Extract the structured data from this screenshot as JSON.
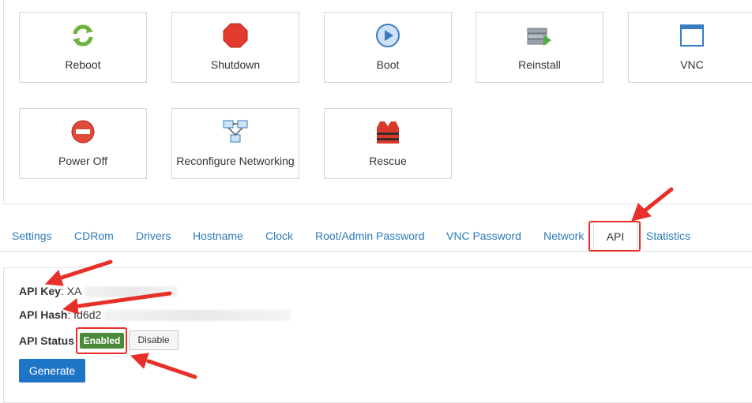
{
  "actions": [
    {
      "label": "Reboot",
      "icon": "reboot-icon"
    },
    {
      "label": "Shutdown",
      "icon": "shutdown-icon"
    },
    {
      "label": "Boot",
      "icon": "boot-icon"
    },
    {
      "label": "Reinstall",
      "icon": "reinstall-icon"
    },
    {
      "label": "VNC",
      "icon": "vnc-icon"
    },
    {
      "label": "Power Off",
      "icon": "power-off-icon"
    },
    {
      "label": "Reconfigure Networking",
      "icon": "network-icon"
    },
    {
      "label": "Rescue",
      "icon": "rescue-icon"
    }
  ],
  "tabs": [
    {
      "label": "Settings"
    },
    {
      "label": "CDRom"
    },
    {
      "label": "Drivers"
    },
    {
      "label": "Hostname"
    },
    {
      "label": "Clock"
    },
    {
      "label": "Root/Admin Password"
    },
    {
      "label": "VNC Password"
    },
    {
      "label": "Network"
    },
    {
      "label": "API",
      "active": true
    },
    {
      "label": "Statistics"
    }
  ],
  "api": {
    "key_label": "API Key",
    "key_value": ": XA",
    "hash_label": "API Hash",
    "hash_value": ": fd6d2",
    "status_label": "API Status",
    "status_badge": "Enabled",
    "disable_label": "Disable",
    "generate_label": "Generate"
  },
  "colors": {
    "link": "#2a7ab8",
    "enabled_badge": "#4a8a3a",
    "generate_button": "#1e74c6",
    "annotation": "#e8302a"
  }
}
